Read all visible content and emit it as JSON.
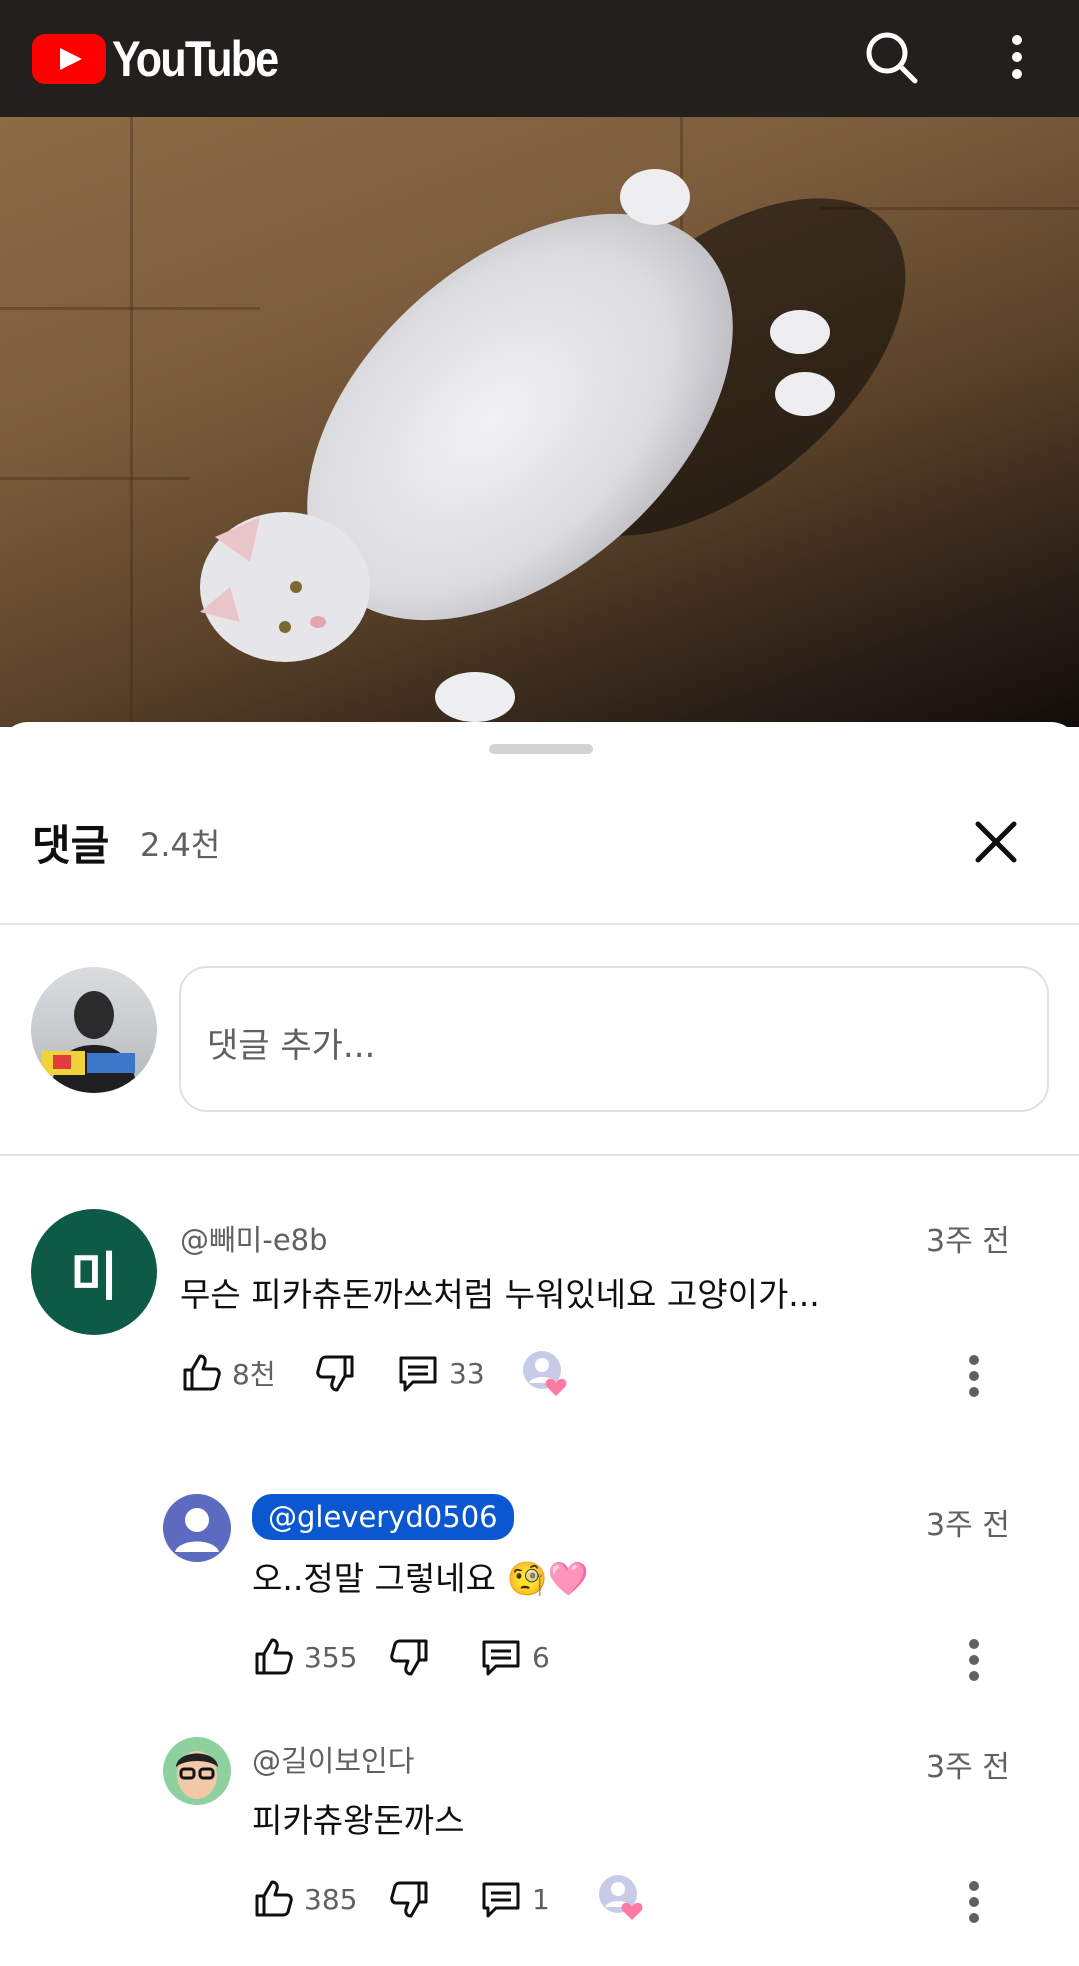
{
  "header": {
    "logo_text": "YouTube",
    "icons": [
      "search-icon",
      "more-vert-icon"
    ]
  },
  "comments_panel": {
    "title": "댓글",
    "count": "2.4천",
    "input_placeholder": "댓글 추가...",
    "icons": [
      "close-icon"
    ]
  },
  "comments": [
    {
      "avatar_letter": "미",
      "avatar_color": "#0d5a47",
      "handle": "@빼미-e8b",
      "time": "3주 전",
      "text": "무슨 피카츄돈까쓰처럼 누워있네요 고양이가...",
      "likes": "8천",
      "replies": "33"
    },
    {
      "handle": "@gleveryd0506",
      "time": "3주 전",
      "text": "오..정말 그렇네요 🧐🩷",
      "likes": "355",
      "replies": "6"
    },
    {
      "handle": "@길이보인다",
      "time": "3주 전",
      "text": "피카츄왕돈까스",
      "likes": "385",
      "replies": "1"
    }
  ],
  "colors": {
    "topbar_bg": "#231f1c",
    "brand_red": "#ff0000",
    "mention_blue": "#0b57d0",
    "secondary_text": "#606060"
  }
}
